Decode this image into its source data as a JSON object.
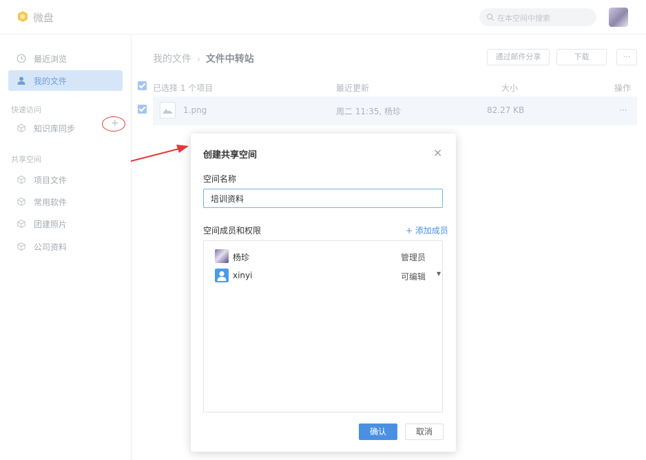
{
  "app": {
    "title": "微盘"
  },
  "search": {
    "placeholder": "在本空间中搜索"
  },
  "sidebar": {
    "top_items": [
      {
        "label": "最近浏览",
        "icon": "clock-icon"
      },
      {
        "label": "我的文件",
        "icon": "user-icon",
        "active": true
      }
    ],
    "quick_access": {
      "title": "快速访问",
      "items": [
        {
          "label": "知识库同步",
          "icon": "cube-icon"
        }
      ]
    },
    "shared": {
      "title": "共享空间",
      "add_label": "+",
      "items": [
        {
          "label": "项目文件",
          "icon": "cube-icon"
        },
        {
          "label": "常用软件",
          "icon": "cube-icon"
        },
        {
          "label": "团建照片",
          "icon": "cube-icon"
        },
        {
          "label": "公司资料",
          "icon": "cube-icon"
        }
      ]
    }
  },
  "breadcrumb": {
    "parent": "我的文件",
    "sep": "›",
    "current": "文件中转站"
  },
  "toolbar": {
    "share_label": "通过邮件分享",
    "download_label": "下载",
    "more_label": "···"
  },
  "table": {
    "headers": {
      "selected": "已选择 1 个项目",
      "updated": "最近更新",
      "size": "大小",
      "action": "操作"
    },
    "rows": [
      {
        "name": "1.png",
        "updated": "周二 11:35, 杨珍",
        "size": "82.27 KB",
        "action": "···"
      }
    ]
  },
  "dialog": {
    "title": "创建共享空间",
    "close": "×",
    "name_label": "空间名称",
    "name_value": "培训资料",
    "members_label": "空间成员和权限",
    "add_member": "+ 添加成员",
    "members": [
      {
        "name": "杨珍",
        "role": "管理员"
      },
      {
        "name": "xinyi",
        "role": "可编辑"
      }
    ],
    "dropdown_caret": "▼",
    "confirm": "确认",
    "cancel": "取消"
  },
  "colors": {
    "accent": "#4a90e2",
    "annotation": "#e53935",
    "active_bg": "#d6e6f8"
  }
}
